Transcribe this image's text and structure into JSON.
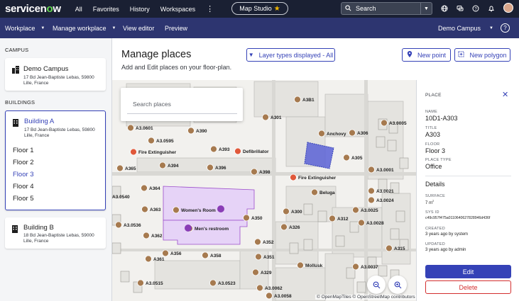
{
  "topbar": {
    "logo_prefix": "servicen",
    "logo_o": "o",
    "logo_suffix": "w",
    "nav": [
      "All",
      "Favorites",
      "History",
      "Workspaces"
    ],
    "kebab": "⋮",
    "map_studio": "Map Studio",
    "search_placeholder": "Search"
  },
  "subbar": {
    "workplace": "Workplace",
    "manage_workplace": "Manage workplace",
    "view_editor": "View editor",
    "preview": "Preview",
    "campus_selector": "Demo Campus"
  },
  "left": {
    "campus_heading": "CAMPUS",
    "campus": {
      "name": "Demo Campus",
      "address": "17 Bd Jean-Baptiste Lebas, 59800 Lille, France"
    },
    "buildings_heading": "BUILDINGS",
    "building_a": {
      "name": "Building A",
      "address": "17 Bd Jean-Baptiste Lebas, 59800 Lille, France"
    },
    "floors": [
      "Floor 1",
      "Floor 2",
      "Floor 3",
      "Floor 4",
      "Floor 5"
    ],
    "selected_floor": "Floor 3",
    "building_b": {
      "name": "Building B",
      "address": "18 Bd Jean-Baptiste Lebas, 59000 Lille, France"
    }
  },
  "header": {
    "title": "Manage places",
    "subtitle": "Add and Edit places on your floor-plan.",
    "layer_types": "Layer types displayed - All",
    "new_point": "New point",
    "new_polygon": "New polygon"
  },
  "map": {
    "search_placeholder": "Search places",
    "attribution": "© OpenMapTiles © OpenStreetMap contributors",
    "labels": [
      "A3B1",
      "A301",
      "A3.0601",
      "A390",
      "A3.0595",
      "Anchovy",
      "A306",
      "A3.0005",
      "Fire Extinguisher",
      "A393",
      "Defibrillator",
      "A305",
      "A365",
      "A394",
      "A396",
      "A398",
      "Fire Extinguisher",
      "A3.0001",
      "A364",
      "Beluga",
      "A3.0021",
      "A3.0540",
      "A3.0024",
      "A363",
      "Women's Room",
      "A300",
      "A3.0025",
      "A350",
      "A312",
      "A3.0536",
      "Men's restroom",
      "A326",
      "A3.0028",
      "A362",
      "A352",
      "A356",
      "A358",
      "A351",
      "A315",
      "A361",
      "Mollusk",
      "A3.0037",
      "A329",
      "A3.0515",
      "A3.0523",
      "A3.0062",
      "A3.0058"
    ]
  },
  "detail": {
    "heading": "PLACE",
    "name_label": "NAME",
    "name": "10D1-A303",
    "title_label": "TITLE",
    "title": "A303",
    "floor_label": "FLOOR",
    "floor": "Floor 3",
    "type_label": "PLACE TYPE",
    "type": "Office",
    "details_heading": "Details",
    "surface_label": "SURFACE",
    "surface_value": "7 m",
    "surface_unit_sup": "2",
    "sysid_label": "SYS ID",
    "sysid": "c49c957f475a0110640627828946d436f",
    "created_label": "CREATED",
    "created": "3 years ago by system",
    "updated_label": "UPDATED",
    "updated": "3 years ago by admin",
    "edit": "Edit",
    "delete": "Delete"
  },
  "colors": {
    "topbar": "#1a2033",
    "subbar": "#2d3570",
    "accent": "#3542b7",
    "danger": "#d32f2f",
    "logo_green": "#62d84e",
    "restroom_fill": "#e6d3f7",
    "selected_room": "#5b62d6"
  }
}
